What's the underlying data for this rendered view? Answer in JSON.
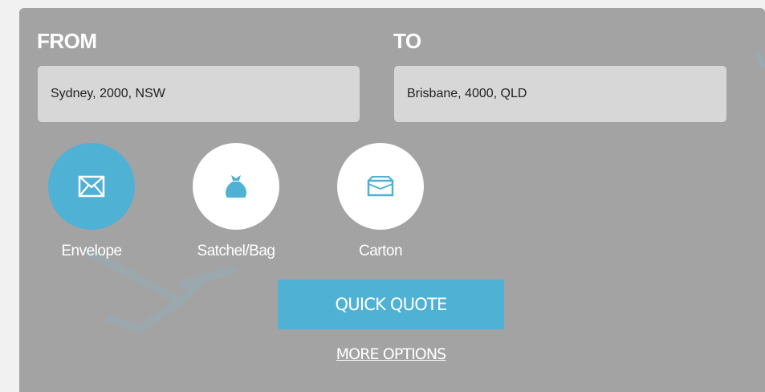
{
  "form": {
    "from_label": "FROM",
    "to_label": "TO",
    "from_value": "Sydney, 2000, NSW",
    "to_value": "Brisbane, 4000, QLD"
  },
  "package_types": [
    {
      "label": "Envelope",
      "icon": "envelope-icon",
      "selected": true
    },
    {
      "label": "Satchel/Bag",
      "icon": "bag-icon",
      "selected": false
    },
    {
      "label": "Carton",
      "icon": "carton-icon",
      "selected": false
    }
  ],
  "actions": {
    "quick_quote": "QUICK QUOTE",
    "more_options": "MORE OPTIONS"
  },
  "colors": {
    "panel": "#a3a3a3",
    "accent": "#4fb1d4",
    "field": "#d7d7d7"
  }
}
